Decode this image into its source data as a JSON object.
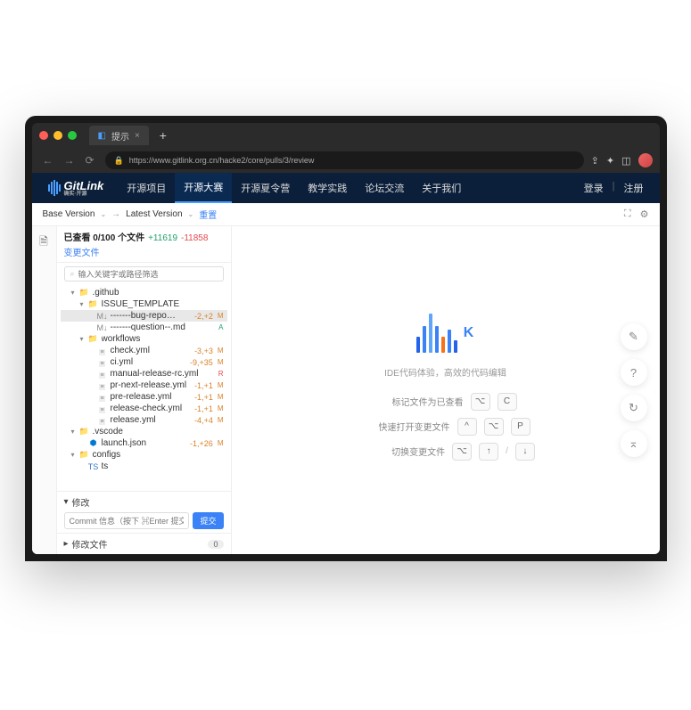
{
  "browser": {
    "tab_title": "提示",
    "url": "https://www.gitlink.org.cn/hacke2/core/pulls/3/review"
  },
  "nav": {
    "brand": "GitLink",
    "brand_sub": "确实·开源",
    "items": [
      "开源项目",
      "开源大赛",
      "开源夏令营",
      "教学实践",
      "论坛交流",
      "关于我们"
    ],
    "login": "登录",
    "register": "注册"
  },
  "version_bar": {
    "base": "Base Version",
    "latest": "Latest Version",
    "reset": "重置"
  },
  "sidebar": {
    "viewed_prefix": "已查看",
    "viewed_count": "0/100",
    "viewed_suffix": "个文件",
    "plus": "+11619",
    "minus": "-11858",
    "changed_files": "变更文件",
    "search_placeholder": "输入关键字或路径筛选",
    "tree": [
      {
        "depth": 1,
        "type": "folder",
        "name": ".github",
        "open": true
      },
      {
        "depth": 2,
        "type": "folder",
        "name": "ISSUE_TEMPLATE",
        "open": true
      },
      {
        "depth": 3,
        "type": "md",
        "name": "-------bug-repo…",
        "stat": "-2,+2",
        "badge": "M",
        "sel": true
      },
      {
        "depth": 3,
        "type": "md",
        "name": "-------question--.md",
        "stat": "",
        "badge": "A"
      },
      {
        "depth": 2,
        "type": "folder",
        "name": "workflows",
        "open": true
      },
      {
        "depth": 3,
        "type": "yml",
        "name": "check.yml",
        "stat": "-3,+3",
        "badge": "M"
      },
      {
        "depth": 3,
        "type": "yml",
        "name": "ci.yml",
        "stat": "-9,+35",
        "badge": "M"
      },
      {
        "depth": 3,
        "type": "yml",
        "name": "manual-release-rc.yml",
        "stat": "",
        "badge": "R"
      },
      {
        "depth": 3,
        "type": "yml",
        "name": "pr-next-release.yml",
        "stat": "-1,+1",
        "badge": "M"
      },
      {
        "depth": 3,
        "type": "yml",
        "name": "pre-release.yml",
        "stat": "-1,+1",
        "badge": "M"
      },
      {
        "depth": 3,
        "type": "yml",
        "name": "release-check.yml",
        "stat": "-1,+1",
        "badge": "M"
      },
      {
        "depth": 3,
        "type": "yml",
        "name": "release.yml",
        "stat": "-4,+4",
        "badge": "M"
      },
      {
        "depth": 1,
        "type": "folder",
        "name": ".vscode",
        "open": true
      },
      {
        "depth": 2,
        "type": "vs",
        "name": "launch.json",
        "stat": "-1,+26",
        "badge": "M"
      },
      {
        "depth": 1,
        "type": "folder",
        "name": "configs",
        "open": true
      },
      {
        "depth": 2,
        "type": "ts",
        "name": "ts",
        "stat": "",
        "badge": ""
      }
    ],
    "modify_header": "修改",
    "commit_placeholder": "Commit 信息（按下 ⌘Enter 提交）",
    "commit_btn": "提交",
    "modified_files": "修改文件",
    "modified_count": "0"
  },
  "welcome": {
    "brand_letters": "K",
    "subtitle": "IDE代码体验，高效的代码编辑",
    "hints": [
      {
        "label": "标记文件为已查看",
        "keys": [
          "⌥",
          "C"
        ]
      },
      {
        "label": "快速打开变更文件",
        "keys": [
          "^",
          "⌥",
          "P"
        ]
      },
      {
        "label": "切换变更文件",
        "keys": [
          "⌥",
          "↑",
          "/",
          "↓"
        ]
      }
    ]
  }
}
